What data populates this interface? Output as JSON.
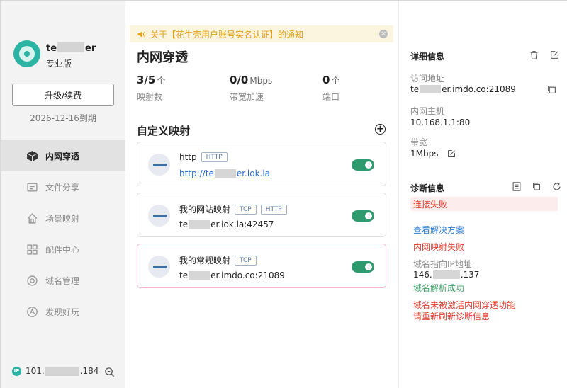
{
  "window": {
    "qr_icon": "qr-code-icon",
    "menu_icon": "hamburger-menu-icon",
    "minimize_icon": "minimize-icon",
    "close_icon": "close-icon"
  },
  "user": {
    "name_prefix": "te",
    "name_suffix": "er",
    "plan": "专业版",
    "upgrade_label": "升级/续费",
    "expire_text": "2026-12-16到期"
  },
  "nav": {
    "items": [
      {
        "label": "内网穿透",
        "icon": "cube-icon",
        "active": true
      },
      {
        "label": "文件分享",
        "icon": "file-share-icon",
        "active": false
      },
      {
        "label": "场景映射",
        "icon": "house-icon",
        "active": false
      },
      {
        "label": "配件中心",
        "icon": "grid-icon",
        "active": false
      },
      {
        "label": "域名管理",
        "icon": "domain-icon",
        "active": false
      },
      {
        "label": "发现好玩",
        "icon": "discover-icon",
        "active": false
      }
    ]
  },
  "ip_bar": {
    "badge": "IP",
    "prefix": "101.",
    "suffix": ".184"
  },
  "notice": {
    "text": "关于【花生壳用户账号实名认证】的通知",
    "close": "×"
  },
  "main": {
    "title": "内网穿透",
    "stats": [
      {
        "value": "3/5",
        "unit": "个",
        "label": "映射数"
      },
      {
        "value": "0/0",
        "unit": "Mbps",
        "label": "带宽加速"
      },
      {
        "value": "0",
        "unit": "个",
        "label": "端口"
      }
    ],
    "section_title": "自定义映射",
    "add_label": "+",
    "mappings": [
      {
        "name": "http",
        "tags": [
          "HTTP"
        ],
        "addr_prefix": "http://te",
        "addr_suffix": "er.iok.la",
        "link": true,
        "enabled": true
      },
      {
        "name": "我的网站映射",
        "tags": [
          "TCP",
          "HTTP"
        ],
        "addr_prefix": "te",
        "addr_suffix": "er.iok.la:42457",
        "link": false,
        "enabled": true
      },
      {
        "name": "我的常规映射",
        "tags": [
          "TCP"
        ],
        "addr_prefix": "te",
        "addr_suffix": "er.imdo.co:21089",
        "link": false,
        "enabled": true
      }
    ]
  },
  "details": {
    "title": "详细信息",
    "access_label": "访问地址",
    "access_prefix": "te",
    "access_suffix": "er.imdo.co:21089",
    "host_label": "内网主机",
    "host_value": "10.168.1.1:80",
    "bandwidth_label": "带宽",
    "bandwidth_value": "1Mbps"
  },
  "diagnosis": {
    "title": "诊断信息",
    "status": "连接失败",
    "solution_link": "查看解决方案",
    "mapping_fail": "内网映射失败",
    "dns_label": "域名指向IP地址",
    "dns_prefix": "146.",
    "dns_suffix": ".137",
    "dns_ok": "域名解析成功",
    "warn_line1": "域名未被激活内网穿透功能",
    "warn_line2": "请重新刷新诊断信息"
  },
  "colors": {
    "accent": "#2bb3a3",
    "toggle_on": "#2e9a6d",
    "link": "#2a6bd2",
    "error": "#e03c2d",
    "success": "#3fa36b",
    "notice": "#e3a117"
  }
}
